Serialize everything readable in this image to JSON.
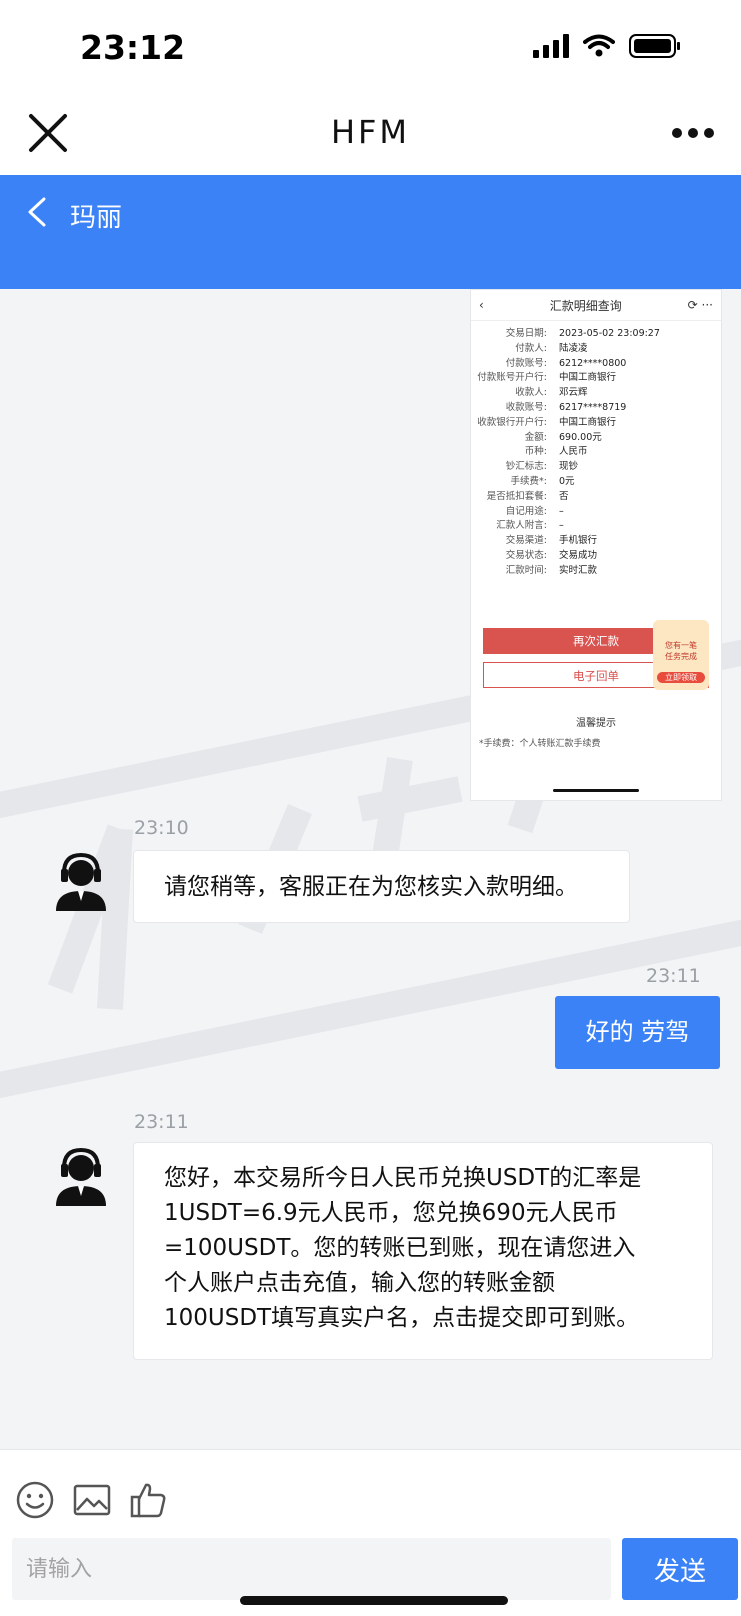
{
  "status_bar": {
    "time": "23:12"
  },
  "nav": {
    "title": "HFM",
    "close_icon": "close-icon",
    "more_icon": "more-icon"
  },
  "chat_header": {
    "title": "玛丽"
  },
  "attachment": {
    "title": "汇款明细查询",
    "rows": [
      {
        "k": "交易日期:",
        "v": "2023-05-02 23:09:27"
      },
      {
        "k": "付款人:",
        "v": "陆凌凌"
      },
      {
        "k": "付款账号:",
        "v": "6212****0800"
      },
      {
        "k": "付款账号开户行:",
        "v": "中国工商银行"
      },
      {
        "k": "收款人:",
        "v": "邓云辉"
      },
      {
        "k": "收款账号:",
        "v": "6217****8719"
      },
      {
        "k": "收款银行开户行:",
        "v": "中国工商银行"
      },
      {
        "k": "金额:",
        "v": "690.00元"
      },
      {
        "k": "币种:",
        "v": "人民币"
      },
      {
        "k": "钞汇标志:",
        "v": "现钞"
      },
      {
        "k": "手续费*:",
        "v": "0元"
      },
      {
        "k": "是否抵扣套餐:",
        "v": "否"
      },
      {
        "k": "自记用途:",
        "v": "–"
      },
      {
        "k": "汇款人附言:",
        "v": "–"
      },
      {
        "k": "交易渠道:",
        "v": "手机银行"
      },
      {
        "k": "交易状态:",
        "v": "交易成功"
      },
      {
        "k": "汇款时间:",
        "v": "实时汇款"
      }
    ],
    "btn_again": "再次汇款",
    "btn_receipt": "电子回单",
    "promo_line1": "您有一笔",
    "promo_line2": "任务完成",
    "promo_cta": "立即领取",
    "tip_title": "温馨提示",
    "tip_body": "*手续费：个人转账汇款手续费"
  },
  "messages": [
    {
      "time": "23:10",
      "side": "in",
      "text": "请您稍等，客服正在为您核实入款明细。"
    },
    {
      "time": "23:11",
      "side": "out",
      "text": "好的 劳驾"
    },
    {
      "time": "23:11",
      "side": "in",
      "lines": [
        "您好，本交易所今日人民币兑换USDT的汇率是",
        "1USDT=6.9元人民币，您兑换690元人民币",
        "=100USDT。您的转账已到账，现在请您进入",
        "个人账户点击充值，输入您的转账金额",
        "100USDT填写真实户名，点击提交即可到账。"
      ]
    }
  ],
  "composer": {
    "placeholder": "请输入",
    "send_label": "发送"
  },
  "colors": {
    "accent": "#3b82f6",
    "bank_red": "#d9534f"
  }
}
